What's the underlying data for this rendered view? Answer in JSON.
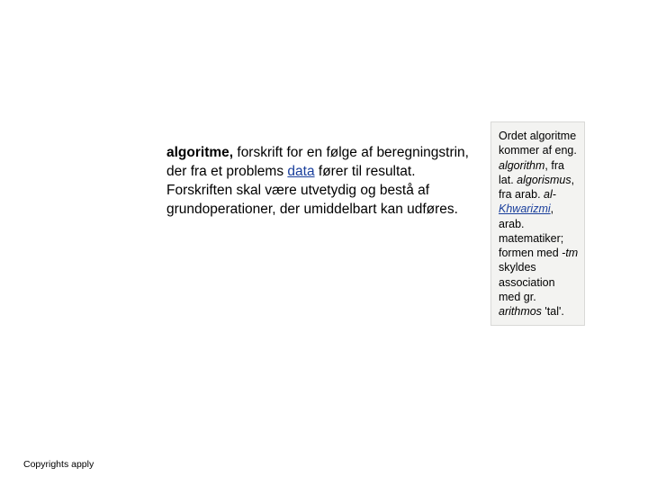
{
  "main": {
    "headword": "algoritme,",
    "body_part1": " forskrift for en følge af beregningstrin, der fra et problems ",
    "link_word": "data",
    "body_part2": " fører til resultat. Forskriften skal være utvetydig og bestå af grundoperationer, der umiddelbart kan udføres."
  },
  "sidebar": {
    "t1": "Ordet algoritme kommer af eng. ",
    "i1": "algorithm",
    "t2": ", fra lat. ",
    "i2": "algorismus",
    "t3": ", fra arab. ",
    "i3": "al-",
    "link": "Khwarizmi",
    "t4": ", arab. matematiker; formen med ",
    "i4": "-tm",
    "t5": " skyldes association med gr. ",
    "i5": "arithmos",
    "t6": " 'tal'."
  },
  "footer": {
    "text": "Copyrights apply"
  }
}
